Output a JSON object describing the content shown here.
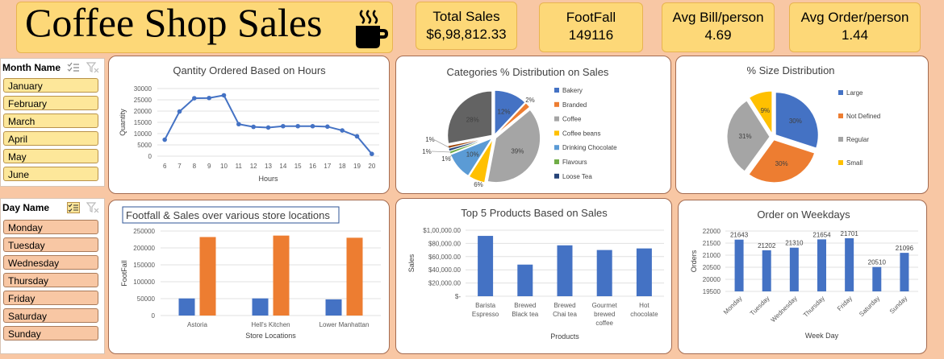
{
  "title": "Coffee Shop Sales",
  "kpis": [
    {
      "label": "Total Sales",
      "value": "$6,98,812.33"
    },
    {
      "label": "FootFall",
      "value": "149116"
    },
    {
      "label": "Avg Bill/person",
      "value": "4.69"
    },
    {
      "label": "Avg Order/person",
      "value": "1.44"
    }
  ],
  "month_slicer": {
    "header": "Month Name",
    "items": [
      "January",
      "February",
      "March",
      "April",
      "May",
      "June"
    ]
  },
  "day_slicer": {
    "header": "Day Name",
    "items": [
      "Monday",
      "Tuesday",
      "Wednesday",
      "Thursday",
      "Friday",
      "Saturday",
      "Sunday"
    ]
  },
  "chart_data": [
    {
      "id": "hours",
      "type": "line",
      "title": "Qantity Ordered Based on Hours",
      "xlabel": "Hours",
      "ylabel": "Quantity",
      "x": [
        6,
        7,
        8,
        9,
        10,
        11,
        12,
        13,
        14,
        15,
        16,
        17,
        18,
        19,
        20
      ],
      "y": [
        7300,
        19800,
        25700,
        25800,
        27000,
        14200,
        13000,
        12700,
        13300,
        13300,
        13300,
        13100,
        11400,
        8800,
        1000
      ],
      "yticks": [
        0,
        5000,
        10000,
        15000,
        20000,
        25000,
        30000
      ],
      "ylim": [
        0,
        30000
      ],
      "color": "#4472c4"
    },
    {
      "id": "categories",
      "type": "pie",
      "title": "Categories % Distribution on Sales",
      "slices": [
        {
          "name": "Bakery",
          "label": "12%",
          "value": 12,
          "color": "#4472c4"
        },
        {
          "name": "Branded",
          "label": "2%",
          "value": 2,
          "color": "#ed7d31"
        },
        {
          "name": "Coffee",
          "label": "39%",
          "value": 39,
          "color": "#a5a5a5"
        },
        {
          "name": "Coffee beans",
          "label": "6%",
          "value": 6,
          "color": "#ffc000"
        },
        {
          "name": "Drinking Chocolate",
          "label": "10%",
          "value": 10,
          "color": "#5b9bd5"
        },
        {
          "name": "Flavours",
          "label": "1%",
          "value": 1,
          "color": "#70ad47"
        },
        {
          "name": "Loose Tea",
          "label": "1%",
          "value": 1,
          "color": "#264478"
        },
        {
          "name": "",
          "label": "1%",
          "value": 1,
          "color": "#9e480e"
        },
        {
          "name": "",
          "label": "28%",
          "value": 28,
          "color": "#636363"
        }
      ],
      "legend": "right"
    },
    {
      "id": "size",
      "type": "pie",
      "title": "% Size Distribution",
      "slices": [
        {
          "name": "Large",
          "label": "30%",
          "value": 30,
          "color": "#4472c4"
        },
        {
          "name": "Not Defined",
          "label": "30%",
          "value": 30,
          "color": "#ed7d31"
        },
        {
          "name": "Regular",
          "label": "31%",
          "value": 31,
          "color": "#a5a5a5"
        },
        {
          "name": "Small",
          "label": "9%",
          "value": 9,
          "color": "#ffc000"
        }
      ],
      "legend": "right"
    },
    {
      "id": "locations",
      "type": "bar",
      "title": "Footfall & Sales over  various store locations",
      "xlabel": "Store Locations",
      "ylabel": "FootFall",
      "categories": [
        "Astoria",
        "Hell's Kitchen",
        "Lower Manhattan"
      ],
      "series": [
        {
          "values": [
            50600,
            50700,
            47800
          ],
          "color": "#4472c4"
        },
        {
          "values": [
            232200,
            236500,
            230100
          ],
          "color": "#ed7d31"
        }
      ],
      "yticks": [
        0,
        50000,
        100000,
        150000,
        200000,
        250000
      ],
      "ylim": [
        0,
        250000
      ]
    },
    {
      "id": "products",
      "type": "bar",
      "title": "Top 5 Products Based on Sales",
      "xlabel": "Products",
      "ylabel": "Sales",
      "categories": [
        [
          "Barista",
          "Espresso"
        ],
        [
          "Brewed",
          "Black tea"
        ],
        [
          "Brewed",
          "Chai tea"
        ],
        [
          "Gourmet",
          "brewed",
          "coffee"
        ],
        [
          "Hot",
          "chocolate"
        ]
      ],
      "values": [
        91400,
        47900,
        77100,
        70000,
        72400
      ],
      "yticks": [
        0,
        20000,
        40000,
        60000,
        80000,
        100000
      ],
      "yticklabels": [
        "$-",
        "$20,000.00",
        "$40,000.00",
        "$60,000.00",
        "$80,000.00",
        "$1,00,000.00"
      ],
      "ylim": [
        0,
        100000
      ],
      "color": "#4472c4"
    },
    {
      "id": "weekdays",
      "type": "bar",
      "title": "Order on Weekdays",
      "xlabel": "Week Day",
      "ylabel": "Orders",
      "categories": [
        "Monday",
        "Tuesday",
        "Wednesday",
        "Thursday",
        "Friday",
        "Saturday",
        "Sunday"
      ],
      "values": [
        21643,
        21202,
        21310,
        21654,
        21701,
        20510,
        21096
      ],
      "yticks": [
        19500,
        20000,
        20500,
        21000,
        21500,
        22000
      ],
      "ylim": [
        19500,
        22000
      ],
      "color": "#4472c4"
    }
  ]
}
